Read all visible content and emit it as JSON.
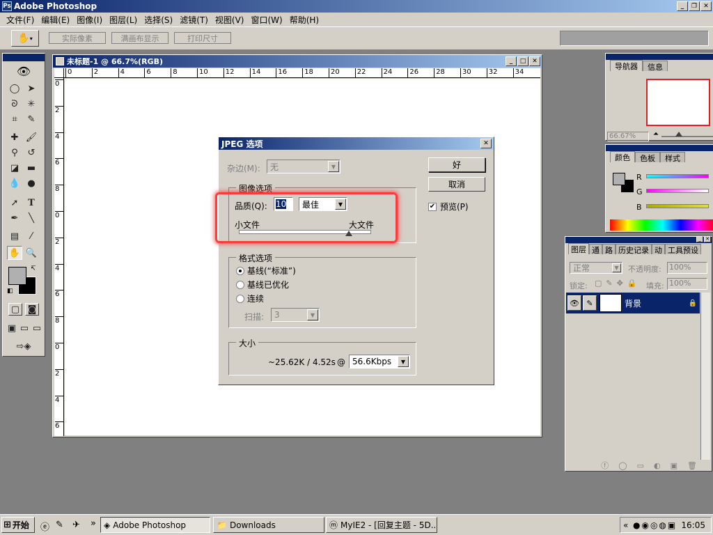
{
  "app": {
    "title": "Adobe Photoshop"
  },
  "menu": [
    "文件(F)",
    "编辑(E)",
    "图像(I)",
    "图层(L)",
    "选择(S)",
    "滤镜(T)",
    "视图(V)",
    "窗口(W)",
    "帮助(H)"
  ],
  "options_bar": {
    "actual_pixels": "实际像素",
    "fit_screen": "满画布显示",
    "print_size": "打印尺寸"
  },
  "document": {
    "title": "未标题-1 @ 66.7%(RGB)",
    "ruler_h": [
      "0",
      "2",
      "4",
      "6",
      "8",
      "10",
      "12",
      "14",
      "16",
      "18",
      "20",
      "22",
      "24",
      "26",
      "28",
      "30",
      "32",
      "34"
    ],
    "ruler_v": [
      "0",
      "2",
      "4",
      "6",
      "8",
      "0",
      "2",
      "4",
      "6",
      "8",
      "0",
      "2",
      "4",
      "6"
    ]
  },
  "dialog": {
    "title": "JPEG 选项",
    "matte_label": "杂边(M):",
    "matte_value": "无",
    "ok": "好",
    "cancel": "取消",
    "preview": "预览(P)",
    "preview_checked": true,
    "image_options": {
      "legend": "图像选项",
      "quality_label": "品质(Q):",
      "quality_value": "10",
      "quality_preset": "最佳",
      "small_file": "小文件",
      "large_file": "大文件",
      "slider_fraction": 0.83
    },
    "format_options": {
      "legend": "格式选项",
      "baseline_standard": "基线(“标准”)",
      "baseline_optimized": "基线已优化",
      "progressive": "连续",
      "scans_label": "扫描:",
      "scans_value": "3",
      "selected": "baseline_standard"
    },
    "size": {
      "legend": "大小",
      "estimate": "~25.62K / 4.52s",
      "at": "@",
      "speed": "56.6Kbps"
    }
  },
  "navigator": {
    "tab_navigator": "导航器",
    "tab_info": "信息",
    "zoom": "66.67%"
  },
  "color_panel": {
    "tab_color": "颜色",
    "tab_swatches": "色板",
    "tab_styles": "样式",
    "r": "R",
    "g": "G",
    "b": "B"
  },
  "layers_panel": {
    "tabs": [
      "图层",
      "通",
      "路",
      "历史记录",
      "动",
      "工具预设"
    ],
    "blend_mode": "正常",
    "opacity_label": "不透明度:",
    "opacity_value": "100%",
    "lock_label": "锁定:",
    "fill_label": "填充:",
    "fill_value": "100%",
    "layer_name": "背景"
  },
  "taskbar": {
    "start": "开始",
    "tasks": [
      "Adobe Photoshop",
      "Downloads",
      "MyIE2 - [回复主题 - 5D..."
    ],
    "chevron": "»",
    "tray_chevron": "«",
    "clock": "16:05"
  },
  "colors": {
    "title_start": "#0a246a",
    "title_end": "#a6caf0",
    "chrome": "#d4d0c8",
    "highlight": "#ff3a3a"
  }
}
